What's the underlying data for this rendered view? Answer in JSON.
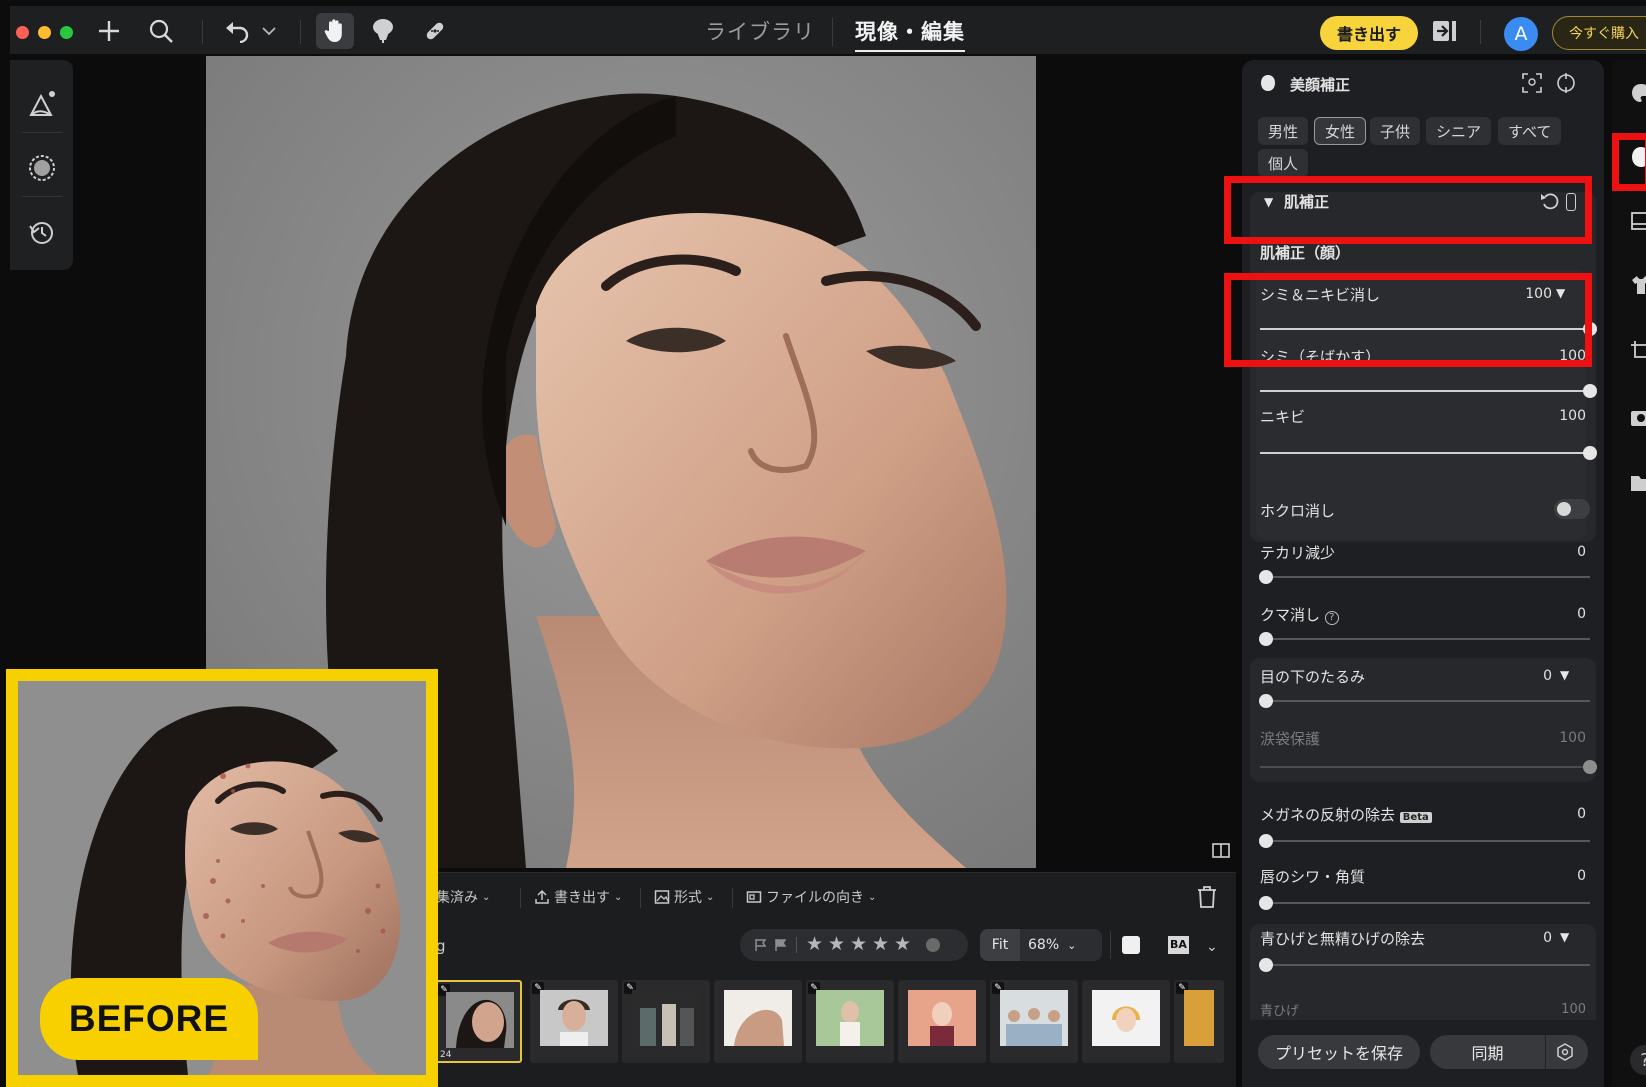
{
  "topbar": {
    "nav_tabs": [
      "ライブラリ",
      "現像・編集"
    ],
    "export_label": "書き出す",
    "avatar_initial": "A",
    "buy_label": "今すぐ購入"
  },
  "photo_toolbar": {
    "menus": [
      "集済み",
      "書き出す",
      "形式",
      "ファイルの向き"
    ],
    "filename_fragment": "g",
    "fit_label": "Fit",
    "zoom_label": "68%",
    "stars": [
      "★",
      "★",
      "★",
      "★",
      "★"
    ],
    "ba_label": "BA",
    "selected_thumb_count": "24"
  },
  "panel": {
    "title": "美顔補正",
    "chips": [
      "男性",
      "女性",
      "子供",
      "シニア",
      "すべて",
      "個人"
    ],
    "active_chip": "女性",
    "section_title": "肌補正",
    "subsection_title": "肌補正（顔）",
    "sliders": {
      "blemish_acne": {
        "label": "シミ＆ニキビ消し",
        "value": "100"
      },
      "freckles": {
        "label": "シミ（そばかす）",
        "value": "100"
      },
      "acne": {
        "label": "ニキビ",
        "value": "100"
      },
      "mole_label": "ホクロ消し",
      "shine": {
        "label": "テカリ減少",
        "value": "0"
      },
      "dark_circles": {
        "label": "クマ消し",
        "value": "0"
      },
      "eye_bags": {
        "label": "目の下のたるみ",
        "value": "0"
      },
      "tear_trough": {
        "label": "涙袋保護",
        "value": "100"
      },
      "glasses": {
        "label": "メガネの反射の除去",
        "value": "0",
        "badge": "Beta"
      },
      "lip_wrinkles": {
        "label": "唇のシワ・角質",
        "value": "0"
      },
      "beard": {
        "label": "青ひげと無精ひげの除去",
        "value": "0"
      },
      "blue_beard": {
        "label": "青ひげ",
        "value": "100"
      }
    },
    "save_preset_label": "プリセットを保存",
    "sync_label": "同期"
  },
  "before_badge": "BEFORE",
  "colors": {
    "accent_yellow": "#f7d33c",
    "highlight_red": "#ee1111",
    "avatar_blue": "#3b8cf2"
  }
}
